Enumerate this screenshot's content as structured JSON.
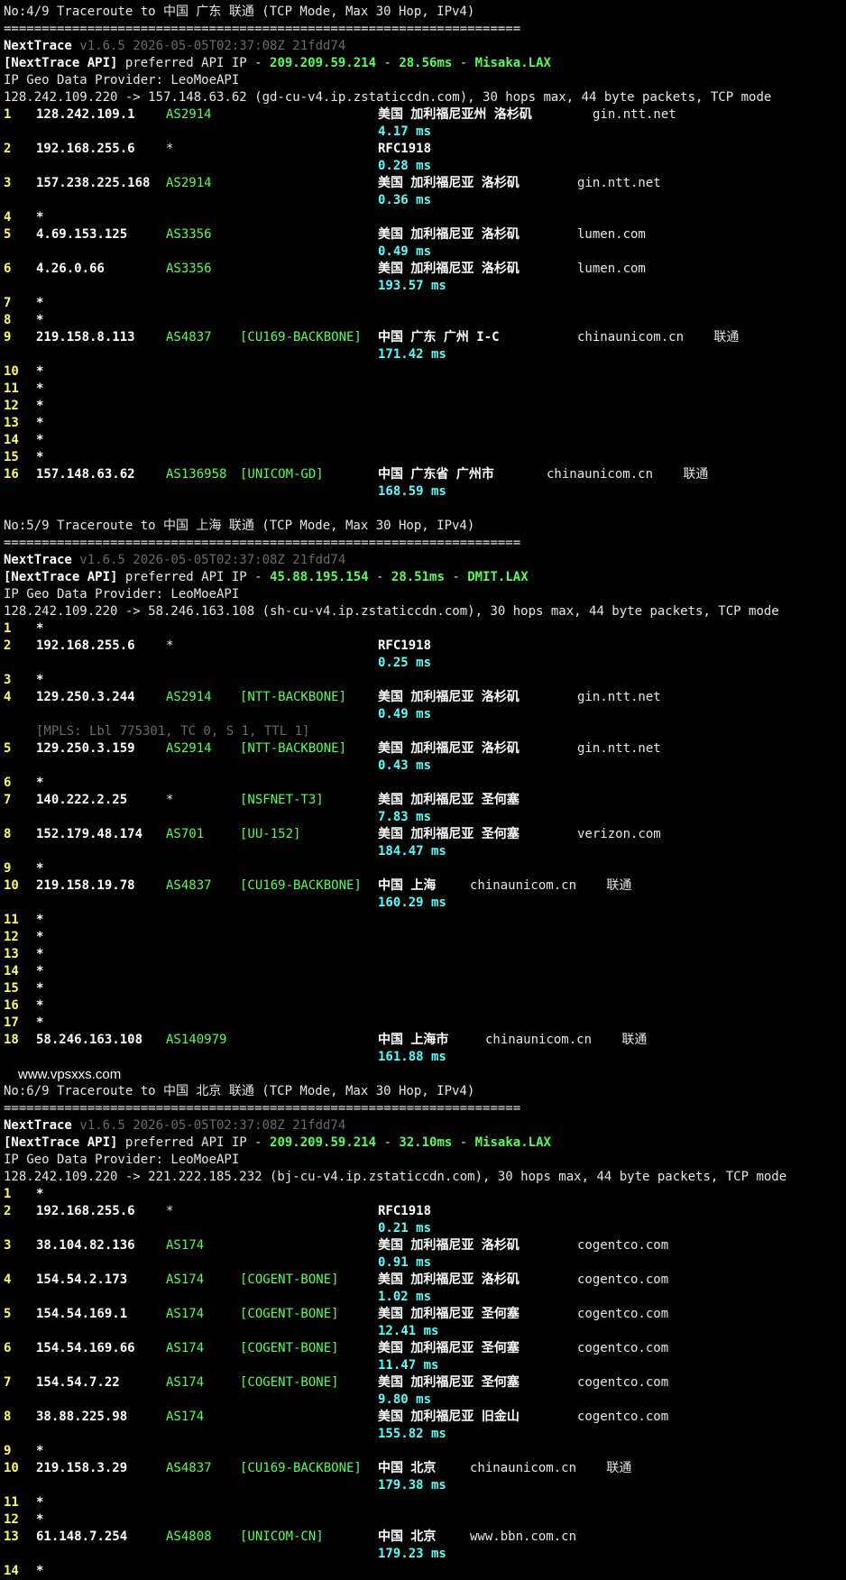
{
  "colors": {
    "background": "#000000",
    "hop_number": "#ffff55",
    "asn": "#55ff55",
    "rtt": "#55ffff",
    "text": "#e6e6e6"
  },
  "separator": "====================================================================",
  "sections": [
    {
      "title": "No:4/9 Traceroute to 中国 广东 联通 (TCP Mode, Max 30 Hop, IPv4)",
      "nexttrace_name": "NextTrace",
      "version": "v1.6.5 2026-05-05T02:37:08Z 21fdd74",
      "api_label": "[NextTrace API]",
      "api_text": " preferred API IP - ",
      "api_ip": "209.209.59.214",
      "api_latency": "28.56ms",
      "api_node": "Misaka.LAX",
      "geo_provider": "IP Geo Data Provider: LeoMoeAPI",
      "route": "128.242.109.220 -> 157.148.63.62 (gd-cu-v4.ip.zstaticcdn.com), 30 hops max, 44 byte packets, TCP mode",
      "hops": [
        {
          "no": "1",
          "ip": "128.242.109.1",
          "asn": "AS2914",
          "tag": "",
          "geo": "美国 加利福尼亚州 洛杉矶",
          "domain": "gin.ntt.net",
          "isp": "",
          "rtt": "4.17 ms",
          "mpls": ""
        },
        {
          "no": "2",
          "ip": "192.168.255.6",
          "asn": "*",
          "tag": "",
          "geo": "RFC1918",
          "domain": "",
          "isp": "",
          "rtt": "0.28 ms",
          "mpls": ""
        },
        {
          "no": "3",
          "ip": "157.238.225.168",
          "asn": "AS2914",
          "tag": "",
          "geo": "美国 加利福尼亚 洛杉矶",
          "domain": "gin.ntt.net",
          "isp": "",
          "rtt": "0.36 ms",
          "mpls": ""
        },
        {
          "no": "4",
          "ip": "*"
        },
        {
          "no": "5",
          "ip": "4.69.153.125",
          "asn": "AS3356",
          "tag": "",
          "geo": "美国 加利福尼亚 洛杉矶",
          "domain": "lumen.com",
          "isp": "",
          "rtt": "0.49 ms",
          "mpls": ""
        },
        {
          "no": "6",
          "ip": "4.26.0.66",
          "asn": "AS3356",
          "tag": "",
          "geo": "美国 加利福尼亚 洛杉矶",
          "domain": "lumen.com",
          "isp": "",
          "rtt": "193.57 ms",
          "mpls": ""
        },
        {
          "no": "7",
          "ip": "*"
        },
        {
          "no": "8",
          "ip": "*"
        },
        {
          "no": "9",
          "ip": "219.158.8.113",
          "asn": "AS4837",
          "tag": "[CU169-BACKBONE]",
          "geo": "中国 广东 广州 I-C",
          "domain": "chinaunicom.cn",
          "isp": "联通",
          "rtt": "171.42 ms",
          "mpls": ""
        },
        {
          "no": "10",
          "ip": "*"
        },
        {
          "no": "11",
          "ip": "*"
        },
        {
          "no": "12",
          "ip": "*"
        },
        {
          "no": "13",
          "ip": "*"
        },
        {
          "no": "14",
          "ip": "*"
        },
        {
          "no": "15",
          "ip": "*"
        },
        {
          "no": "16",
          "ip": "157.148.63.62",
          "asn": "AS136958",
          "tag": "[UNICOM-GD]",
          "geo": "中国 广东省 广州市",
          "domain": "chinaunicom.cn",
          "isp": "联通",
          "rtt": "168.59 ms",
          "mpls": ""
        }
      ]
    },
    {
      "title": "No:5/9 Traceroute to 中国 上海 联通 (TCP Mode, Max 30 Hop, IPv4)",
      "nexttrace_name": "NextTrace",
      "version": "v1.6.5 2026-05-05T02:37:08Z 21fdd74",
      "api_label": "[NextTrace API]",
      "api_text": " preferred API IP - ",
      "api_ip": "45.88.195.154",
      "api_latency": "28.51ms",
      "api_node": "DMIT.LAX",
      "geo_provider": "IP Geo Data Provider: LeoMoeAPI",
      "route": "128.242.109.220 -> 58.246.163.108 (sh-cu-v4.ip.zstaticcdn.com), 30 hops max, 44 byte packets, TCP mode",
      "hops": [
        {
          "no": "1",
          "ip": "*"
        },
        {
          "no": "2",
          "ip": "192.168.255.6",
          "asn": "*",
          "tag": "",
          "geo": "RFC1918",
          "domain": "",
          "isp": "",
          "rtt": "0.25 ms",
          "mpls": ""
        },
        {
          "no": "3",
          "ip": "*"
        },
        {
          "no": "4",
          "ip": "129.250.3.244",
          "asn": "AS2914",
          "tag": "[NTT-BACKBONE]",
          "geo": "美国 加利福尼亚 洛杉矶",
          "domain": "gin.ntt.net",
          "isp": "",
          "rtt": "0.49 ms",
          "mpls": "[MPLS: Lbl 775301, TC 0, S 1, TTL 1]"
        },
        {
          "no": "5",
          "ip": "129.250.3.159",
          "asn": "AS2914",
          "tag": "[NTT-BACKBONE]",
          "geo": "美国 加利福尼亚 洛杉矶",
          "domain": "gin.ntt.net",
          "isp": "",
          "rtt": "0.43 ms",
          "mpls": ""
        },
        {
          "no": "6",
          "ip": "*"
        },
        {
          "no": "7",
          "ip": "140.222.2.25",
          "asn": "*",
          "tag": "[NSFNET-T3]",
          "geo": "美国 加利福尼亚 圣何塞",
          "domain": "",
          "isp": "",
          "rtt": "7.83 ms",
          "mpls": ""
        },
        {
          "no": "8",
          "ip": "152.179.48.174",
          "asn": "AS701",
          "tag": "[UU-152]",
          "geo": "美国 加利福尼亚 圣何塞",
          "domain": "verizon.com",
          "isp": "",
          "rtt": "184.47 ms",
          "mpls": ""
        },
        {
          "no": "9",
          "ip": "*"
        },
        {
          "no": "10",
          "ip": "219.158.19.78",
          "asn": "AS4837",
          "tag": "[CU169-BACKBONE]",
          "geo": "中国 上海",
          "domain": "chinaunicom.cn",
          "isp": "联通",
          "rtt": "160.29 ms",
          "mpls": ""
        },
        {
          "no": "11",
          "ip": "*"
        },
        {
          "no": "12",
          "ip": "*"
        },
        {
          "no": "13",
          "ip": "*"
        },
        {
          "no": "14",
          "ip": "*"
        },
        {
          "no": "15",
          "ip": "*"
        },
        {
          "no": "16",
          "ip": "*"
        },
        {
          "no": "17",
          "ip": "*"
        },
        {
          "no": "18",
          "ip": "58.246.163.108",
          "asn": "AS140979",
          "tag": "",
          "geo": "中国 上海市",
          "domain": "chinaunicom.cn",
          "isp": "联通",
          "rtt": "161.88 ms",
          "mpls": ""
        }
      ]
    },
    {
      "title": "No:6/9 Traceroute to 中国 北京 联通 (TCP Mode, Max 30 Hop, IPv4)",
      "nexttrace_name": "NextTrace",
      "version": "v1.6.5 2026-05-05T02:37:08Z 21fdd74",
      "api_label": "[NextTrace API]",
      "api_text": " preferred API IP - ",
      "api_ip": "209.209.59.214",
      "api_latency": "32.10ms",
      "api_node": "Misaka.LAX",
      "geo_provider": "IP Geo Data Provider: LeoMoeAPI",
      "route": "128.242.109.220 -> 221.222.185.232 (bj-cu-v4.ip.zstaticcdn.com), 30 hops max, 44 byte packets, TCP mode",
      "hops": [
        {
          "no": "1",
          "ip": "*"
        },
        {
          "no": "2",
          "ip": "192.168.255.6",
          "asn": "*",
          "tag": "",
          "geo": "RFC1918",
          "domain": "",
          "isp": "",
          "rtt": "0.21 ms",
          "mpls": ""
        },
        {
          "no": "3",
          "ip": "38.104.82.136",
          "asn": "AS174",
          "tag": "",
          "geo": "美国 加利福尼亚 洛杉矶",
          "domain": "cogentco.com",
          "isp": "",
          "rtt": "0.91 ms",
          "mpls": ""
        },
        {
          "no": "4",
          "ip": "154.54.2.173",
          "asn": "AS174",
          "tag": "[COGENT-BONE]",
          "geo": "美国 加利福尼亚 洛杉矶",
          "domain": "cogentco.com",
          "isp": "",
          "rtt": "1.02 ms",
          "mpls": ""
        },
        {
          "no": "5",
          "ip": "154.54.169.1",
          "asn": "AS174",
          "tag": "[COGENT-BONE]",
          "geo": "美国 加利福尼亚 圣何塞",
          "domain": "cogentco.com",
          "isp": "",
          "rtt": "12.41 ms",
          "mpls": ""
        },
        {
          "no": "6",
          "ip": "154.54.169.66",
          "asn": "AS174",
          "tag": "[COGENT-BONE]",
          "geo": "美国 加利福尼亚 圣何塞",
          "domain": "cogentco.com",
          "isp": "",
          "rtt": "11.47 ms",
          "mpls": ""
        },
        {
          "no": "7",
          "ip": "154.54.7.22",
          "asn": "AS174",
          "tag": "[COGENT-BONE]",
          "geo": "美国 加利福尼亚 圣何塞",
          "domain": "cogentco.com",
          "isp": "",
          "rtt": "9.80 ms",
          "mpls": ""
        },
        {
          "no": "8",
          "ip": "38.88.225.98",
          "asn": "AS174",
          "tag": "",
          "geo": "美国 加利福尼亚 旧金山",
          "domain": "cogentco.com",
          "isp": "",
          "rtt": "155.82 ms",
          "mpls": ""
        },
        {
          "no": "9",
          "ip": "*"
        },
        {
          "no": "10",
          "ip": "219.158.3.29",
          "asn": "AS4837",
          "tag": "[CU169-BACKBONE]",
          "geo": "中国 北京",
          "domain": "chinaunicom.cn",
          "isp": "联通",
          "rtt": "179.38 ms",
          "mpls": ""
        },
        {
          "no": "11",
          "ip": "*"
        },
        {
          "no": "12",
          "ip": "*"
        },
        {
          "no": "13",
          "ip": "61.148.7.254",
          "asn": "AS4808",
          "tag": "[UNICOM-CN]",
          "geo": "中国 北京",
          "domain": "www.bbn.com.cn",
          "isp": "",
          "rtt": "179.23 ms",
          "mpls": ""
        },
        {
          "no": "14",
          "ip": "*"
        }
      ]
    }
  ],
  "watermark": "www.vpsxxs.com"
}
